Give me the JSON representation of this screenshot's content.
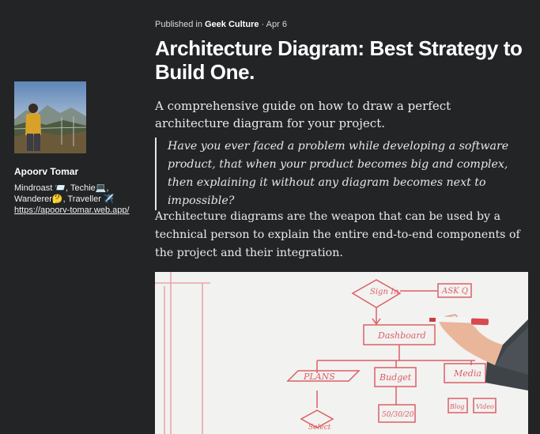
{
  "author": {
    "name": "Apoorv Tomar",
    "bio_line1": "Mindroast 📨, Techie💻,",
    "bio_line2": "Wanderer🤔, Traveller ✈️",
    "link": "https://apoorv-tomar.web.app/"
  },
  "article": {
    "published_prefix": "Published in",
    "publication": "Geek Culture",
    "date_sep": "·",
    "date": "Apr 6",
    "title": "Architecture Diagram: Best Strategy to Build One.",
    "subtitle": "A comprehensive guide on how to draw a perfect architecture diagram for your project.",
    "quote": "Have you ever faced a problem while developing a software product, that when your product becomes big and complex, then explaining it without any diagram becomes next to impossible?",
    "paragraph": "Architecture diagrams are the weapon that can be used by a technical person to explain the entire end-to-end components of the project and their integration."
  },
  "hero": {
    "labels": {
      "sign_in": "Sign In",
      "ask_q": "ASK Q",
      "dashboard": "Dashboard",
      "plans": "PLANS",
      "budget": "Budget",
      "media": "Media",
      "ratio": "50/30/20",
      "blog": "Blog",
      "video": "Video",
      "select": "Select"
    },
    "marker_color": "#d9494e"
  }
}
